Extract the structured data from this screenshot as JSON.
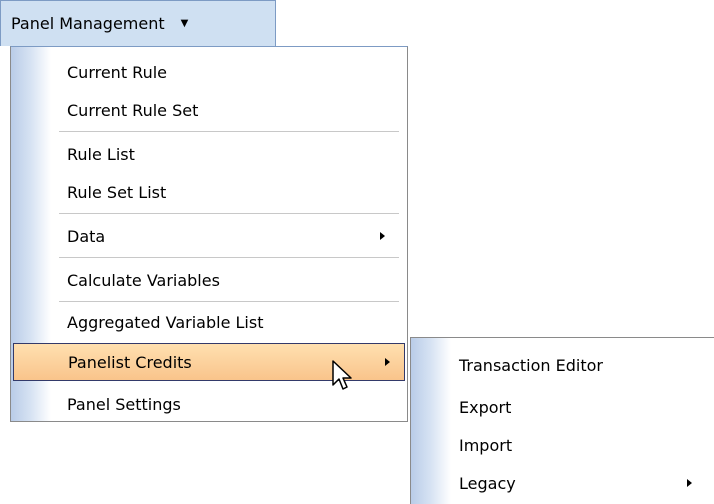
{
  "menubar": {
    "title": "Panel Management",
    "dropdown_icon": "triangle-down-icon"
  },
  "main_menu": {
    "items": [
      {
        "label": "Current Rule"
      },
      {
        "label": "Current Rule Set"
      },
      {
        "label": "Rule List"
      },
      {
        "label": "Rule Set List"
      },
      {
        "label": "Data",
        "has_submenu": true
      },
      {
        "label": "Calculate Variables"
      },
      {
        "label": "Aggregated Variable List"
      },
      {
        "label": "Panelist Credits",
        "has_submenu": true,
        "active": true
      },
      {
        "label": "Panel Settings"
      }
    ]
  },
  "sub_menu": {
    "parent": "Panelist Credits",
    "items": [
      {
        "label": "Transaction Editor"
      },
      {
        "label": "Export"
      },
      {
        "label": "Import"
      },
      {
        "label": "Legacy",
        "has_submenu": true
      }
    ]
  },
  "colors": {
    "menubar_bg": "#cfe0f2",
    "highlight": "#f9c48b",
    "highlight_border": "#333a6a",
    "gutter": "#b9cce8"
  }
}
